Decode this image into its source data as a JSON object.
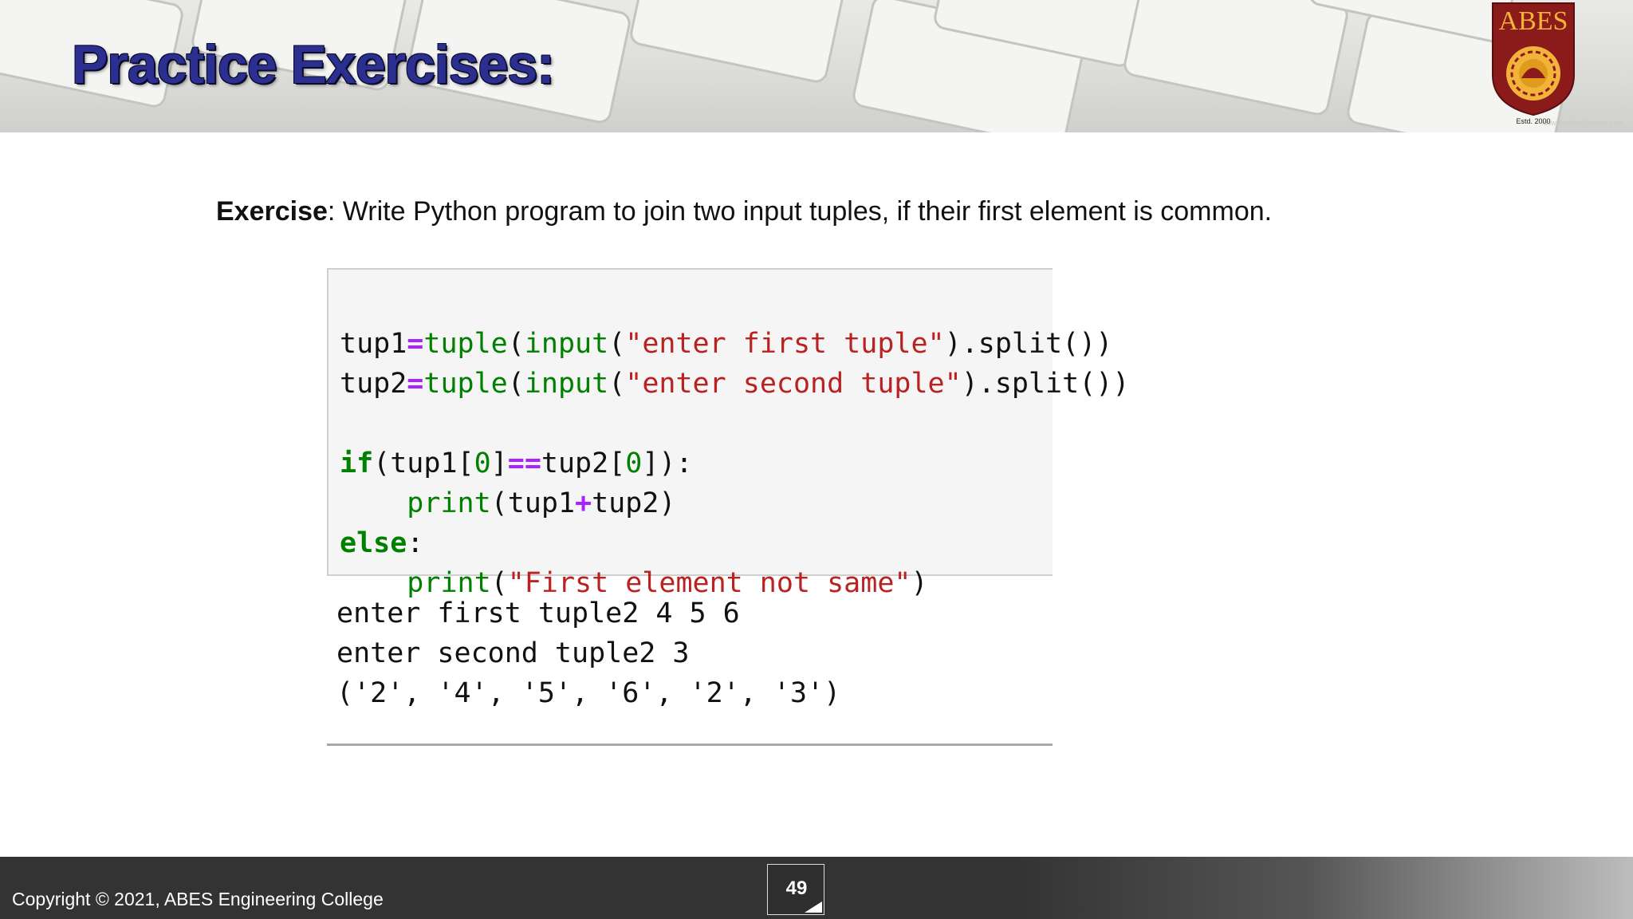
{
  "slide": {
    "title": "Practice Exercises:",
    "watermark": "downloadwallpapers.com",
    "logo": {
      "name": "ABES",
      "estd": "Estd. 2000"
    },
    "exercise": {
      "label": "Exercise",
      "text": ": Write Python program to join two input tuples, if their first element is common."
    },
    "code": {
      "line1": {
        "var": "tup1",
        "eq": "=",
        "f1": "tuple",
        "p1": "(",
        "f2": "input",
        "p2": "(",
        "s": "\"enter first tuple\"",
        "rest": ").split())"
      },
      "line2": {
        "var": "tup2",
        "eq": "=",
        "f1": "tuple",
        "p1": "(",
        "f2": "input",
        "p2": "(",
        "s": "\"enter second tuple\"",
        "rest": ").split())"
      },
      "line4": {
        "kw": "if",
        "a": "(tup1[",
        "n1": "0",
        "b": "]",
        "op": "==",
        "c": "tup2[",
        "n2": "0",
        "d": "]):"
      },
      "line5": {
        "indent": "    ",
        "fn": "print",
        "a": "(tup1",
        "op": "+",
        "b": "tup2)"
      },
      "line6": {
        "kw": "else",
        "a": ":"
      },
      "line7": {
        "indent": "    ",
        "fn": "print",
        "a": "(",
        "s": "\"First element not same\"",
        "b": ")"
      }
    },
    "output": [
      "enter first tuple2 4 5 6",
      "enter second tuple2 3",
      "('2', '4', '5', '6', '2', '3')"
    ],
    "footer": {
      "copyright": "Copyright © 2021, ABES Engineering College",
      "page_number": "49"
    },
    "colors": {
      "title": "#2b2f8f",
      "keyword": "#008000",
      "string": "#ba2121",
      "operator": "#aa22ff",
      "footer_bg": "#333333",
      "logo_crest": "#8b1a1a",
      "logo_gold": "#f2b33a"
    }
  }
}
